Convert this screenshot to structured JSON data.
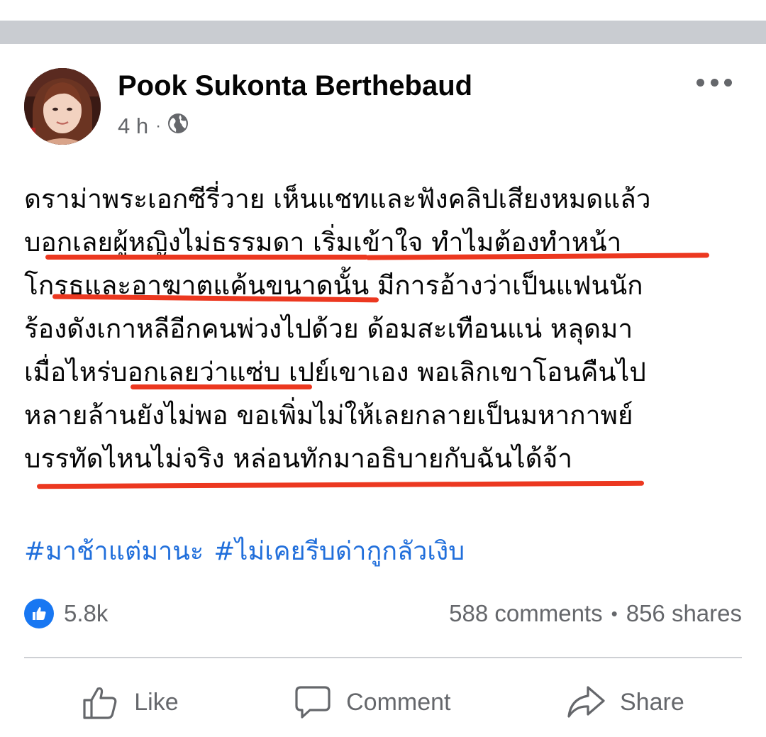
{
  "post": {
    "author": "Pook Sukonta Berthebaud",
    "time": "4 h",
    "audience_icon": "globe-icon",
    "more_icon": "more-options-icon",
    "text_lines": [
      "ดราม่าพระเอกซีรี่วาย เห็นแชทและฟังคลิปเสียงหมดแล้ว",
      "บอกเลยผู้หญิงไม่ธรรมดา เริ่มเข้าใจ ทำไมต้องทำหน้า",
      "โกรธและอาฆาตแค้นขนาดนั้น มีการอ้างว่าเป็นแฟนนัก",
      "ร้องดังเกาหลีอีกคนพ่วงไปด้วย ด้อมสะเทือนแน่ หลุดมา",
      "เมื่อไหร่บอกเลยว่าแซ่บ เปย์เขาเอง พอเลิกเขาโอนคืนไป",
      "หลายล้านยังไม่พอ ขอเพิ่มไม่ให้เลยกลายเป็นมหากาพย์",
      "บรรทัดไหนไม่จริง หล่อนทักมาอธิบายกับฉันได้จ้า"
    ],
    "hashtags": [
      "#มาช้าแต่มานะ",
      "#ไม่เคยรีบด่ากูกลัวเงิบ"
    ],
    "link_color": "#216fdb",
    "annotation_color": "#ec3820"
  },
  "stats": {
    "reactions_icon": "like-reaction-icon",
    "reactions_count": "5.8k",
    "comments": "588 comments",
    "separator": "•",
    "shares": "856 shares"
  },
  "actions": {
    "like_label": "Like",
    "comment_label": "Comment",
    "share_label": "Share"
  },
  "colors": {
    "brand_blue": "#1877f2",
    "secondary_text": "#65676b",
    "divider": "#ced0d4"
  }
}
